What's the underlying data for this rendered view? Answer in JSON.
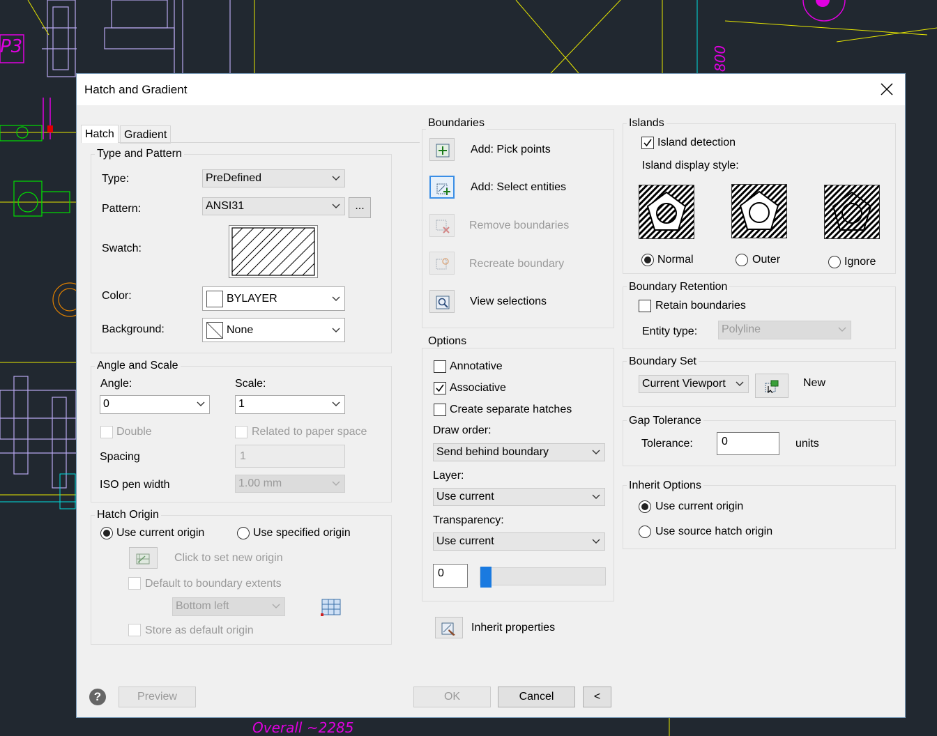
{
  "dialog": {
    "title": "Hatch and Gradient"
  },
  "background_cad": {
    "label_p3": "P3",
    "label_800": "800",
    "label_overall": "Overall ~2285"
  },
  "tabs": [
    {
      "label": "Hatch",
      "active": true
    },
    {
      "label": "Gradient",
      "active": false
    }
  ],
  "type_pattern": {
    "title": "Type and Pattern",
    "type_label": "Type:",
    "type_value": "PreDefined",
    "pattern_label": "Pattern:",
    "pattern_value": "ANSI31",
    "browse_label": "...",
    "swatch_label": "Swatch:",
    "color_label": "Color:",
    "color_value": "BYLAYER",
    "background_label": "Background:",
    "background_value": "None"
  },
  "angle_scale": {
    "title": "Angle and Scale",
    "angle_label": "Angle:",
    "angle_value": "0",
    "scale_label": "Scale:",
    "scale_value": "1",
    "double_label": "Double",
    "double_checked": false,
    "paper_label": "Related to paper space",
    "paper_checked": false,
    "spacing_label": "Spacing",
    "spacing_value": "1",
    "iso_label": "ISO pen width",
    "iso_value": "1.00 mm"
  },
  "hatch_origin": {
    "title": "Hatch Origin",
    "use_current": "Use current origin",
    "use_current_selected": true,
    "use_specified": "Use specified origin",
    "use_specified_selected": false,
    "click_set": "Click to set new origin",
    "default_extents": "Default to boundary extents",
    "default_extents_checked": false,
    "position_value": "Bottom left",
    "store_default": "Store as default origin",
    "store_default_checked": false
  },
  "boundaries": {
    "title": "Boundaries",
    "pick_points": "Add: Pick points",
    "select_entities": "Add: Select entities",
    "remove": "Remove boundaries",
    "recreate": "Recreate boundary",
    "view_selections": "View selections"
  },
  "options": {
    "title": "Options",
    "annotative": "Annotative",
    "annotative_checked": false,
    "associative": "Associative",
    "associative_checked": true,
    "separate": "Create separate hatches",
    "separate_checked": false,
    "draw_order_label": "Draw order:",
    "draw_order_value": "Send behind boundary",
    "layer_label": "Layer:",
    "layer_value": "Use current",
    "transparency_label": "Transparency:",
    "transparency_value": "Use current",
    "transparency_amount": "0",
    "transparency_slider_fraction": 0.0
  },
  "inherit_properties": "Inherit properties",
  "islands": {
    "title": "Islands",
    "detection": "Island detection",
    "detection_checked": true,
    "display_style_label": "Island display style:",
    "normal": "Normal",
    "outer": "Outer",
    "ignore": "Ignore",
    "selected": "Normal"
  },
  "boundary_retention": {
    "title": "Boundary Retention",
    "retain": "Retain boundaries",
    "retain_checked": false,
    "entity_type_label": "Entity type:",
    "entity_type_value": "Polyline"
  },
  "boundary_set": {
    "title": "Boundary Set",
    "value": "Current Viewport",
    "new_label": "New"
  },
  "gap_tolerance": {
    "title": "Gap Tolerance",
    "tolerance_label": "Tolerance:",
    "tolerance_value": "0",
    "units_label": "units"
  },
  "inherit_options": {
    "title": "Inherit Options",
    "use_current": "Use current origin",
    "use_current_selected": true,
    "use_source": "Use source hatch origin",
    "use_source_selected": false
  },
  "footer": {
    "help_icon": "?",
    "preview": "Preview",
    "ok": "OK",
    "cancel": "Cancel",
    "more": "<"
  },
  "colors": {
    "cad_background": "#212830",
    "dialog_background": "#f0f0f0",
    "selection_blue": "#3a8ee6",
    "cad_magenta": "#e000e0"
  }
}
